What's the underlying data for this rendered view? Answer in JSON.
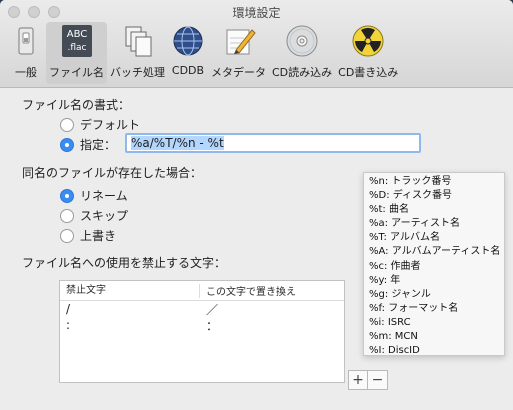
{
  "window": {
    "title": "環境設定"
  },
  "toolbar": {
    "items": [
      {
        "label": "一般",
        "icon": "phone-switch-icon"
      },
      {
        "label": "ファイル名",
        "icon": "abc-flac-icon",
        "icon_text_1": "ABC",
        "icon_text_2": ".flac",
        "active": true
      },
      {
        "label": "バッチ処理",
        "icon": "documents-stack-icon"
      },
      {
        "label": "CDDB",
        "icon": "globe-icon"
      },
      {
        "label": "メタデータ",
        "icon": "pencil-note-icon"
      },
      {
        "label": "CD読み込み",
        "icon": "cd-disc-icon"
      },
      {
        "label": "CD書き込み",
        "icon": "radiation-disc-icon"
      }
    ]
  },
  "filename_format": {
    "heading": "ファイル名の書式：",
    "option_default": "デフォルト",
    "option_custom": "指定：",
    "selected": "custom",
    "value": "%a/%T/%n - %t"
  },
  "duplicate": {
    "heading": "同名のファイルが存在した場合：",
    "options": [
      "リネーム",
      "スキップ",
      "上書き"
    ],
    "selected_index": 0
  },
  "forbidden": {
    "heading": "ファイル名への使用を禁止する文字：",
    "columns": [
      "禁止文字",
      "この文字で置き換え"
    ],
    "rows": [
      {
        "char": "/",
        "replacement": "／"
      },
      {
        "char": ":",
        "replacement": "："
      }
    ],
    "add_label": "+",
    "remove_label": "−"
  },
  "tokens": [
    "%n: トラック番号",
    "%D: ディスク番号",
    "%t: 曲名",
    "%a: アーティスト名",
    "%T: アルバム名",
    "%A: アルバムアーティスト名",
    "%c: 作曲者",
    "%y: 年",
    "%g: ジャンル",
    "%f: フォーマット名",
    "%i: ISRC",
    "%m: MCN",
    "%I: DiscID"
  ],
  "colors": {
    "accent": "#3b8cf1",
    "selection": "#b3d6fd",
    "focus_ring": "#8fb9ee"
  }
}
